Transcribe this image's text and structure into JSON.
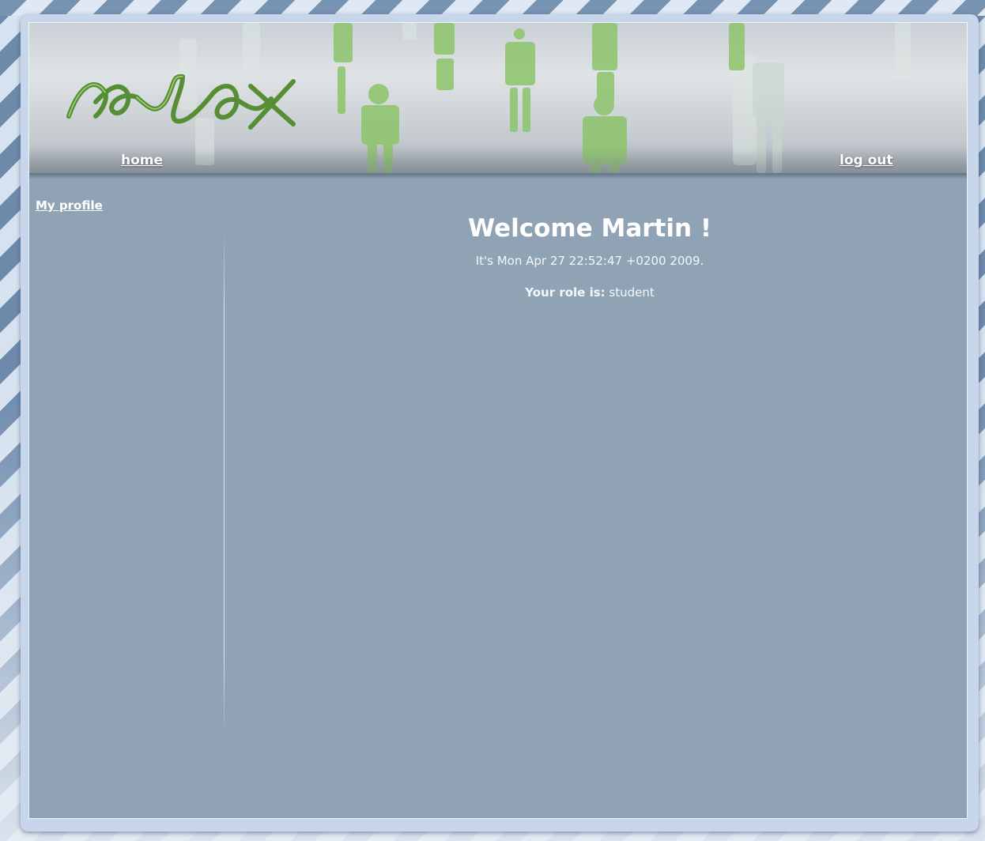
{
  "header": {
    "logo_text": "relax",
    "nav": {
      "home_label": "home",
      "logout_label": "log out"
    }
  },
  "sidebar": {
    "items": [
      {
        "label": "My profile"
      }
    ]
  },
  "main": {
    "welcome": "Welcome Martin !",
    "date_line": "It's Mon Apr 27 22:52:47 +0200 2009.",
    "role_label": "Your role is:",
    "role_value": "student"
  },
  "colors": {
    "content_background": "#8fa3b5",
    "frame": "#c7d6ea",
    "logo_green": "#4e8a2a",
    "figure_green": "#8cc46a",
    "text": "#ffffff"
  },
  "icons": {
    "logo": "relax-script-logo",
    "banner_art": "glass-figures-illustration"
  }
}
